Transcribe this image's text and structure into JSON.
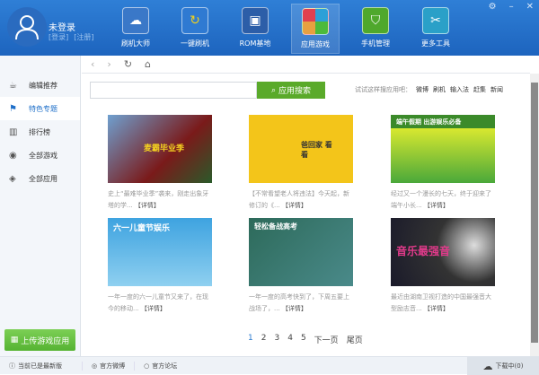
{
  "user": {
    "name": "未登录",
    "login": "[登录]",
    "register": "[注册]"
  },
  "nav": [
    {
      "label": "刷机大师",
      "icon": "cloud-icon"
    },
    {
      "label": "一键刷机",
      "icon": "refresh-icon"
    },
    {
      "label": "ROM基地",
      "icon": "android-icon"
    },
    {
      "label": "应用游戏",
      "icon": "apps-icon"
    },
    {
      "label": "手机管理",
      "icon": "shield-phone-icon"
    },
    {
      "label": "更多工具",
      "icon": "tools-icon"
    }
  ],
  "sidebar": [
    {
      "label": "编辑推荐"
    },
    {
      "label": "特色专题"
    },
    {
      "label": "排行榜"
    },
    {
      "label": "全部游戏"
    },
    {
      "label": "全部应用"
    }
  ],
  "upload_label": "上传游戏应用",
  "search": {
    "placeholder": "",
    "button": "应用搜索",
    "hint": "试试这样搜应用吧：",
    "hints": [
      "微博",
      "刷机",
      "输入法",
      "赶集",
      "新闻"
    ]
  },
  "cards": [
    {
      "img_text": "麦霸毕业季",
      "desc": "史上“最难毕业季”袭来，刚走出象牙塔的学...",
      "more": "【详情】",
      "color": "#7a1a1a"
    },
    {
      "img_text": "爸回家 看看",
      "desc": "【不常看望老人将违法】今天起，新修订的《...",
      "more": "【详情】",
      "color": "#f3c51a"
    },
    {
      "img_text": "端午假期 出游娱乐必备",
      "desc": "经过又一个漫长的七天，终于迎来了端午小长...",
      "more": "【详情】",
      "color": "#3b8a2a"
    },
    {
      "img_text": "六一儿童节娱乐",
      "desc": "一年一度的六一儿童节又来了，在现今的移动...",
      "more": "【详情】",
      "color": "#3ea3e0"
    },
    {
      "img_text": "轻松备战高考",
      "desc": "一年一度的高考快到了，下周五要上战场了，...",
      "more": "【详情】",
      "color": "#2d6a5a"
    },
    {
      "img_text": "音乐最强音",
      "desc": "最近由湖南卫视打造的中国最强音大型励志音...",
      "more": "【详情】",
      "color": "#8a2a4a"
    }
  ],
  "pager": [
    "1",
    "2",
    "3",
    "4",
    "5",
    "下一页",
    "尾页"
  ],
  "status": {
    "version": "当前已是最新版",
    "weibo": "官方微博",
    "forum": "官方论坛",
    "download": "下载中(0)"
  }
}
